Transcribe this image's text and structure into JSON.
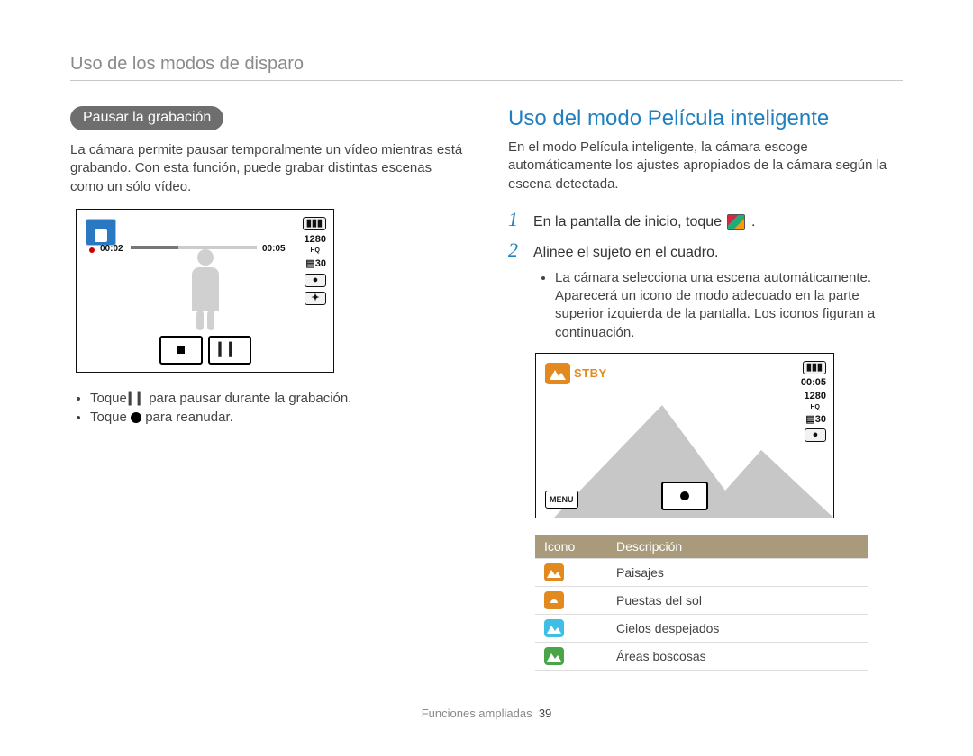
{
  "breadcrumb": "Uso de los modos de disparo",
  "left": {
    "pill": "Pausar la grabación",
    "intro": "La cámara permite pausar temporalmente un vídeo mientras está grabando. Con esta función, puede grabar distintas escenas como un sólo vídeo.",
    "ss1": {
      "elapsed": "00:02",
      "total": "00:05",
      "res_label": "1280",
      "res_sub": "HQ",
      "fps_label": "30"
    },
    "bullets": {
      "b1a": "Toque ",
      "b1b": " para pausar durante la grabación.",
      "b2a": "Toque ",
      "b2b": " para reanudar."
    }
  },
  "right": {
    "title": "Uso del modo Película inteligente",
    "intro": "En el modo Película inteligente, la cámara escoge automáticamente los ajustes apropiados de la cámara según la escena detectada.",
    "steps": {
      "s1a": "En la pantalla de inicio, toque ",
      "s1b": ".",
      "s2": "Alinee el sujeto en el cuadro."
    },
    "sub_bullet": "La cámara selecciona una escena automáticamente. Aparecerá un icono de modo adecuado en la parte superior izquierda de la pantalla. Los iconos figuran a continuación.",
    "ss2": {
      "stby": "STBY",
      "time": "00:05",
      "res_label": "1280",
      "res_sub": "HQ",
      "fps_label": "30",
      "menu": "MENU"
    },
    "table": {
      "head_icon": "Icono",
      "head_desc": "Descripción",
      "rows": [
        {
          "desc": "Paisajes"
        },
        {
          "desc": "Puestas del sol"
        },
        {
          "desc": "Cielos despejados"
        },
        {
          "desc": "Áreas boscosas"
        }
      ]
    }
  },
  "footer": {
    "section": "Funciones ampliadas",
    "page": "39"
  }
}
